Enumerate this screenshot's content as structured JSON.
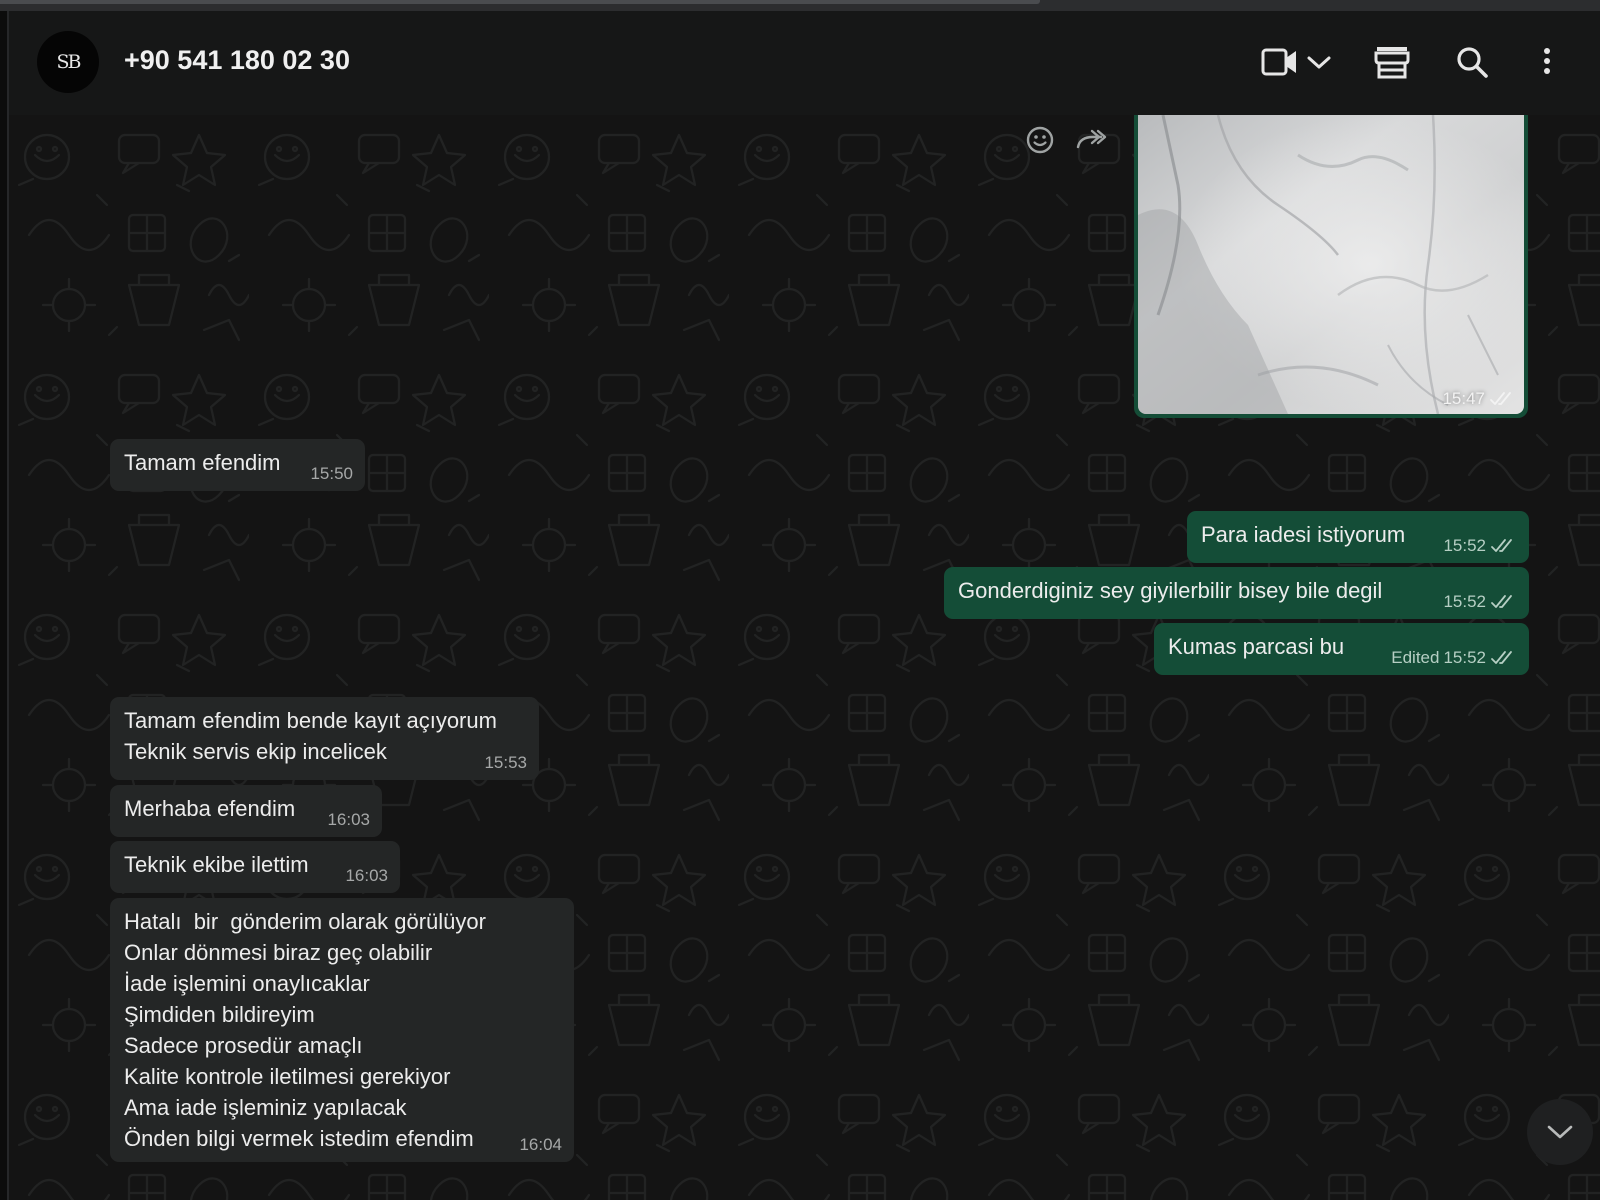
{
  "header": {
    "avatar_initials": "SB",
    "contact_name": "+90 541 180 02 30",
    "icons": [
      "video-call-icon",
      "chevron-down-icon",
      "store-icon",
      "search-icon",
      "more-options-icon"
    ]
  },
  "colors": {
    "incoming_bubble": "#242626",
    "outgoing_bubble": "#144d37",
    "chat_background": "#141414",
    "header_background": "#161717"
  },
  "messages": [
    {
      "direction": "outgoing",
      "type": "image",
      "time": "15:47",
      "status": "read"
    },
    {
      "direction": "incoming",
      "text": "Tamam efendim",
      "time": "15:50"
    },
    {
      "direction": "outgoing",
      "text": "Para iadesi istiyorum",
      "time": "15:52",
      "status": "read"
    },
    {
      "direction": "outgoing",
      "text": "Gonderdiginiz sey giyilerbilir bisey bile degil",
      "time": "15:52",
      "status": "read"
    },
    {
      "direction": "outgoing",
      "text": "Kumas parcasi bu",
      "time": "15:52",
      "edited_label": "Edited",
      "status": "read"
    },
    {
      "direction": "incoming",
      "text": "Tamam efendim bende kayıt açıyorum\nTeknik servis ekip incelicek",
      "time": "15:53"
    },
    {
      "direction": "incoming",
      "text": "Merhaba efendim",
      "time": "16:03"
    },
    {
      "direction": "incoming",
      "text": "Teknik ekibe ilettim",
      "time": "16:03"
    },
    {
      "direction": "incoming",
      "text": "Hatalı  bir  gönderim olarak görülüyor\nOnlar dönmesi biraz geç olabilir\nİade işlemini onaylıcaklar\nŞimdiden bildireyim\nSadece prosedür amaçlı\nKalite kontrole iletilmesi gerekiyor\nAma iade işleminiz yapılacak\nÖnden bilgi vermek istedim efendim",
      "time": "16:04"
    }
  ]
}
